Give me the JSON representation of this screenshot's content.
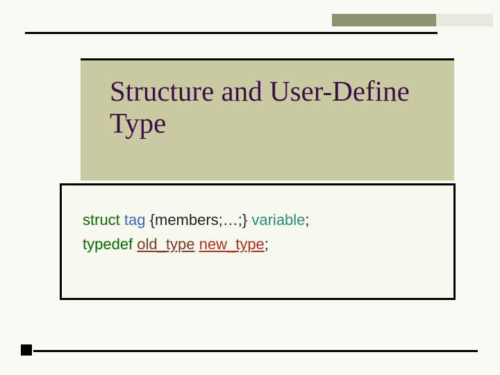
{
  "title": "Structure and User-Define Type",
  "line1": {
    "struct": "struct",
    "space1": "  ",
    "tag": "tag",
    "space2": " ",
    "members": "{members;…;}",
    "space3": " ",
    "variable": "variable",
    "semi": ";"
  },
  "line2": {
    "typedef": "typedef",
    "space1": " ",
    "old": "old_type",
    "space2": "  ",
    "new": "new_type",
    "semi": ";"
  }
}
